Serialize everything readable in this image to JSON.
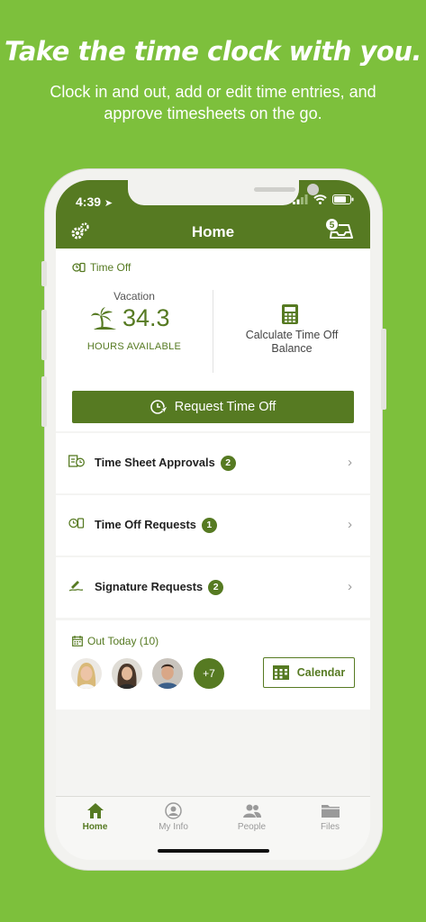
{
  "marketing": {
    "headline": "Take the time clock with you.",
    "subline": "Clock in and out, add or edit time entries, and approve timesheets on the go."
  },
  "status_bar": {
    "time": "4:39"
  },
  "nav": {
    "title": "Home",
    "inbox_badge": "5"
  },
  "time_off": {
    "section_label": "Time Off",
    "type_label": "Vacation",
    "balance": "34.3",
    "balance_caption": "HOURS AVAILABLE",
    "calc_label": "Calculate Time Off Balance",
    "request_button": "Request Time Off"
  },
  "rows": [
    {
      "label": "Time Sheet Approvals",
      "count": "2"
    },
    {
      "label": "Time Off Requests",
      "count": "1"
    },
    {
      "label": "Signature Requests",
      "count": "2"
    }
  ],
  "out_today": {
    "label": "Out Today (10)",
    "more": "+7",
    "calendar_button": "Calendar"
  },
  "tabs": [
    {
      "label": "Home",
      "icon": "home-icon",
      "active": true
    },
    {
      "label": "My Info",
      "icon": "person-circle-icon",
      "active": false
    },
    {
      "label": "People",
      "icon": "people-icon",
      "active": false
    },
    {
      "label": "Files",
      "icon": "folder-icon",
      "active": false
    }
  ],
  "colors": {
    "background": "#7dc03c",
    "brand": "#567a22"
  }
}
